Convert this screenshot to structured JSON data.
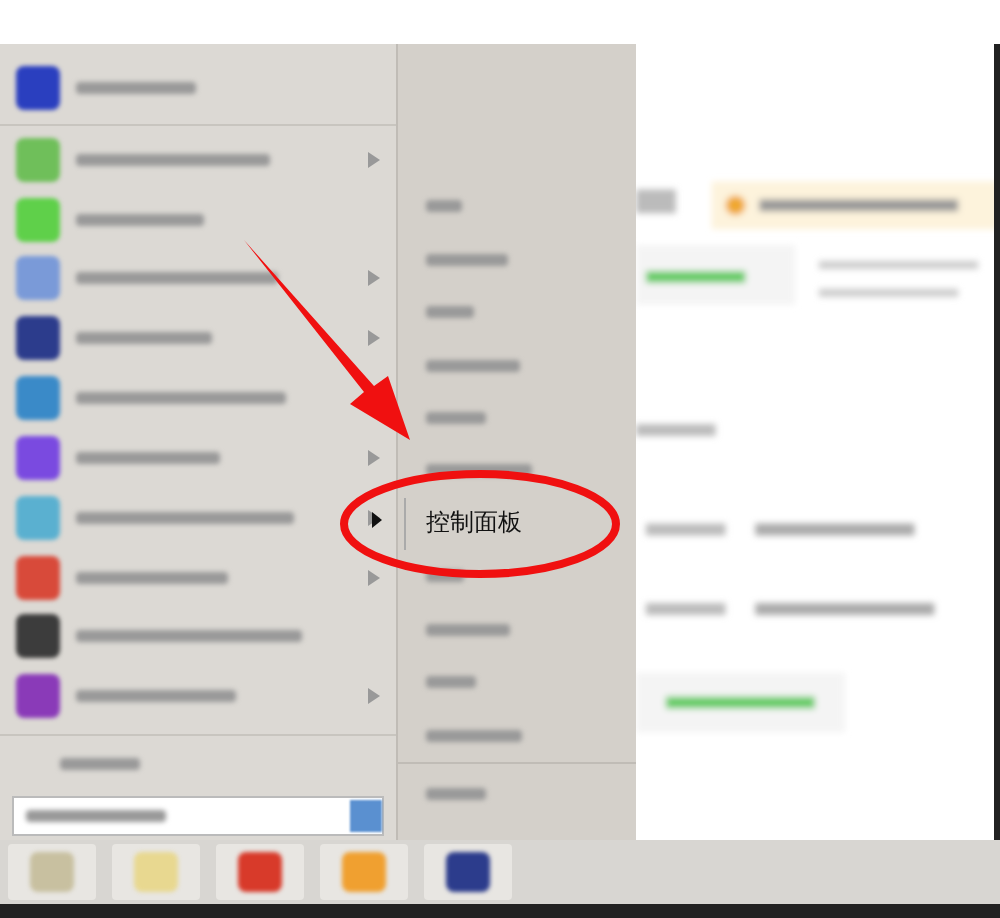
{
  "start_menu": {
    "programs": [
      {
        "color": "#2a3fbf",
        "submenu": false
      },
      {
        "color": "#6fbf5a",
        "submenu": true
      },
      {
        "color": "#5fd04a",
        "submenu": false
      },
      {
        "color": "#7a9ad8",
        "submenu": true
      },
      {
        "color": "#2c3c8c",
        "submenu": true
      },
      {
        "color": "#3a8ac8",
        "submenu": false
      },
      {
        "color": "#7a4ae0",
        "submenu": true
      },
      {
        "color": "#5ab0d0",
        "submenu": true
      },
      {
        "color": "#d84a3a",
        "submenu": true
      },
      {
        "color": "#3c3c3c",
        "submenu": false
      },
      {
        "color": "#8a3ab8",
        "submenu": true
      }
    ],
    "places": [
      {
        "kind": "blurred"
      },
      {
        "kind": "blurred"
      },
      {
        "kind": "blurred"
      },
      {
        "kind": "blurred"
      },
      {
        "kind": "blurred"
      },
      {
        "kind": "blurred"
      },
      {
        "kind": "text",
        "text": "控制面板"
      },
      {
        "kind": "blurred"
      },
      {
        "kind": "blurred"
      },
      {
        "kind": "blurred"
      },
      {
        "kind": "blurred"
      }
    ]
  },
  "taskbar": {
    "icons": [
      {
        "color": "#c8c0a0"
      },
      {
        "color": "#e8d890"
      },
      {
        "color": "#d83a2a"
      },
      {
        "color": "#f0a030"
      },
      {
        "color": "#2c3c8c"
      }
    ]
  }
}
